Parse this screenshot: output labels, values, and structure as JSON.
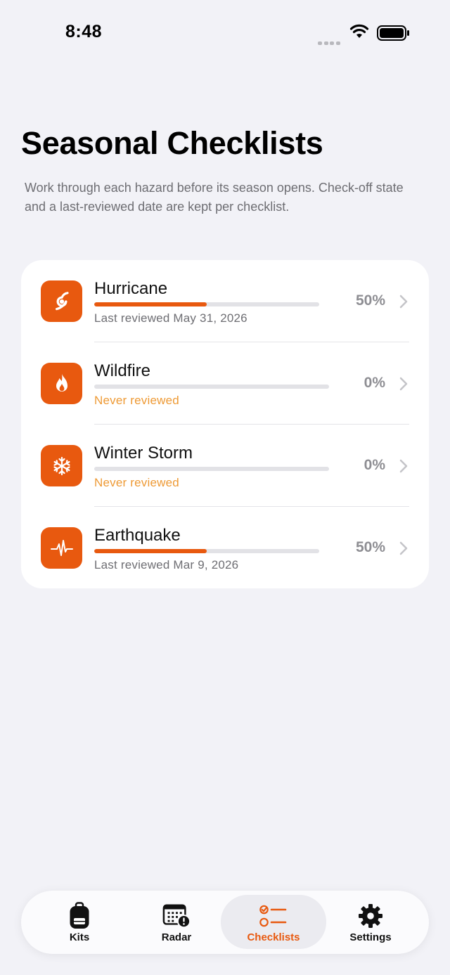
{
  "status": {
    "time": "8:48"
  },
  "header": {
    "title": "Seasonal Checklists",
    "subtitle": "Work through each hazard before its season opens. Check-off state and a last-reviewed date are kept per checklist."
  },
  "checklists": [
    {
      "name": "Hurricane",
      "icon": "hurricane-icon",
      "progress": 0.5,
      "percent": "50%",
      "reviewed": "Last reviewed May 31, 2026",
      "never": false
    },
    {
      "name": "Wildfire",
      "icon": "flame-icon",
      "progress": 0,
      "percent": "0%",
      "reviewed": "Never reviewed",
      "never": true
    },
    {
      "name": "Winter Storm",
      "icon": "snowflake-icon",
      "progress": 0,
      "percent": "0%",
      "reviewed": "Never reviewed",
      "never": true
    },
    {
      "name": "Earthquake",
      "icon": "waveform-icon",
      "progress": 0.5,
      "percent": "50%",
      "reviewed": "Last reviewed Mar 9, 2026",
      "never": false
    }
  ],
  "tabs": [
    {
      "label": "Kits",
      "icon": "backpack-icon",
      "active": false
    },
    {
      "label": "Radar",
      "icon": "calendar-alert-icon",
      "active": false
    },
    {
      "label": "Checklists",
      "icon": "checklist-icon",
      "active": true
    },
    {
      "label": "Settings",
      "icon": "gear-icon",
      "active": false
    }
  ],
  "colors": {
    "accent": "#e8590f",
    "never_reviewed": "#ee9a35",
    "background": "#f2f2f7",
    "secondary_text": "#6e6e73"
  }
}
